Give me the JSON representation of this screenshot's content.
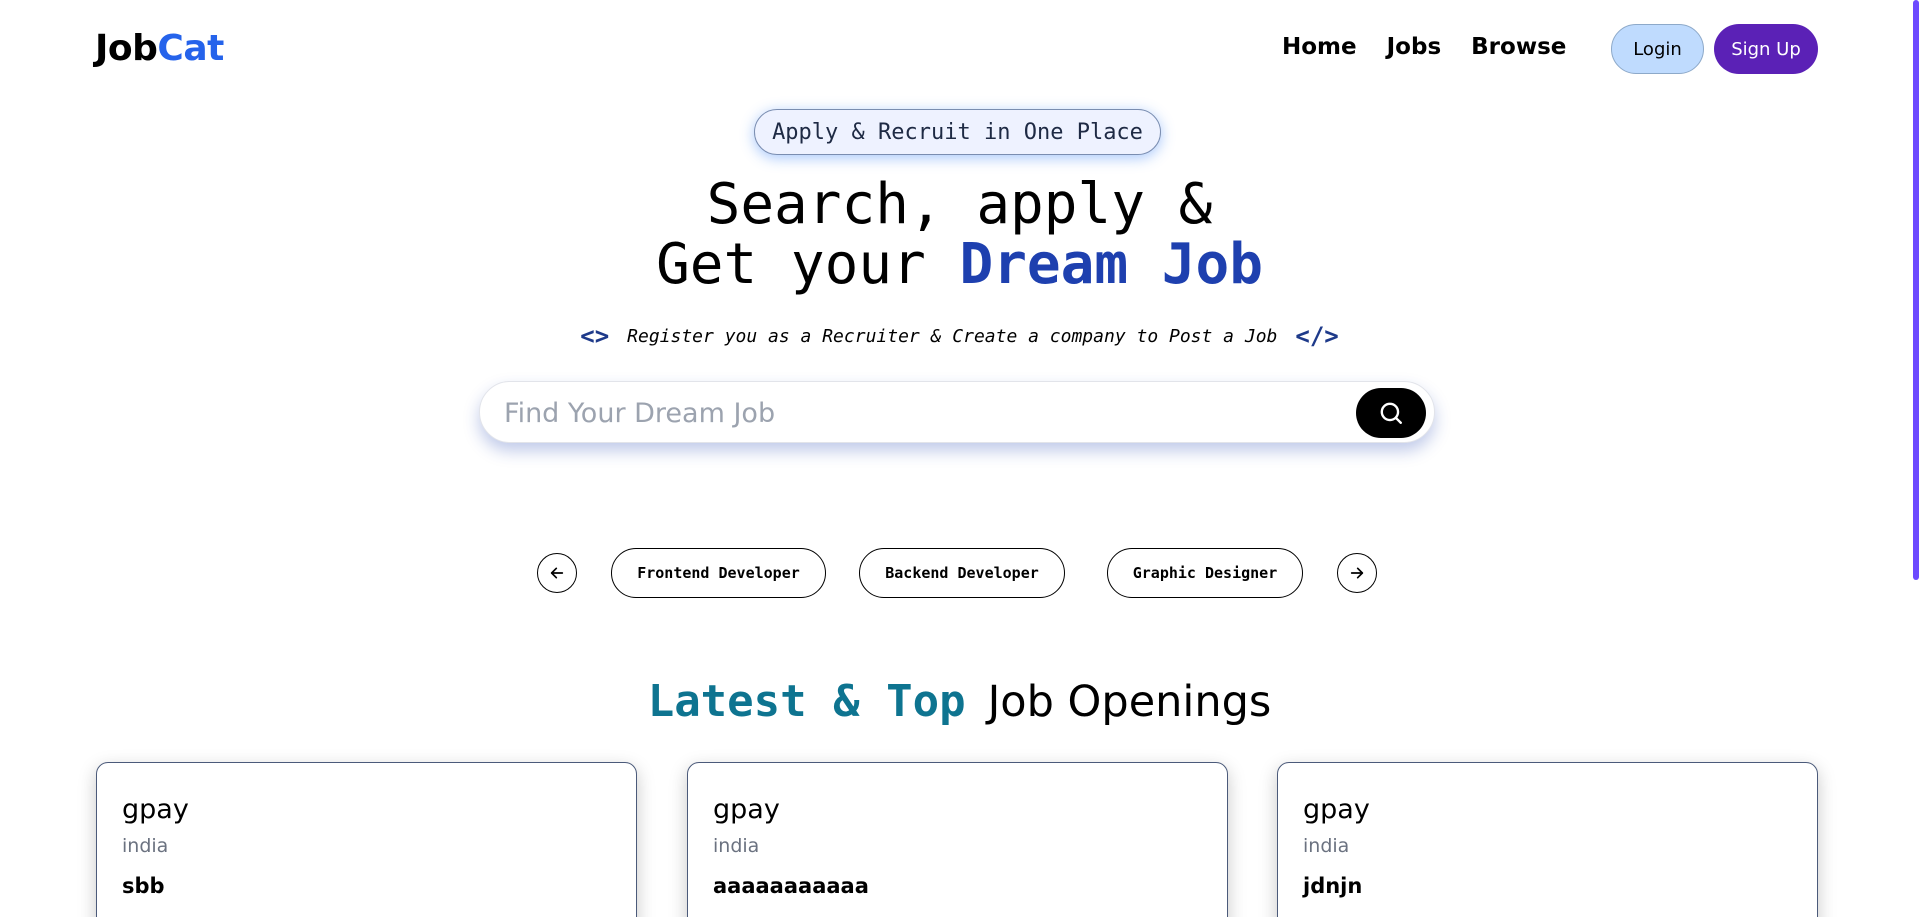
{
  "navbar": {
    "logo_part1": "Job",
    "logo_part2": "Cat",
    "links": [
      {
        "label": "Home"
      },
      {
        "label": "Jobs"
      },
      {
        "label": "Browse"
      }
    ],
    "login_label": "Login",
    "signup_label": "Sign Up"
  },
  "hero": {
    "badge": "Apply & Recruit in One Place",
    "title_line1": "Search, apply &",
    "title_line2_prefix": "Get your ",
    "title_line2_highlight": "Dream Job",
    "tag_open": "<>",
    "tagline": "Register you as a Recruiter & Create a company to Post a Job",
    "tag_close": "</>"
  },
  "search": {
    "placeholder": "Find Your Dream Job",
    "value": "",
    "button_icon": "search-icon"
  },
  "carousel": {
    "prev_icon": "arrow-left-icon",
    "next_icon": "arrow-right-icon",
    "categories": [
      {
        "label": "Frontend Developer"
      },
      {
        "label": "Backend Developer"
      },
      {
        "label": "Graphic Designer"
      }
    ]
  },
  "section": {
    "title_accent": "Latest & Top",
    "title_main": "Job Openings"
  },
  "jobs": [
    {
      "company": "gpay",
      "location": "india",
      "title": "sbb"
    },
    {
      "company": "gpay",
      "location": "india",
      "title": "aaaaaaaaaaa"
    },
    {
      "company": "gpay",
      "location": "india",
      "title": "jdnjn"
    }
  ],
  "colors": {
    "brand_blue": "#2563eb",
    "signup_purple": "#5b21b6",
    "login_bg": "#bfdbfe",
    "dream_job": "#1e40af",
    "section_accent": "#0e7490"
  }
}
